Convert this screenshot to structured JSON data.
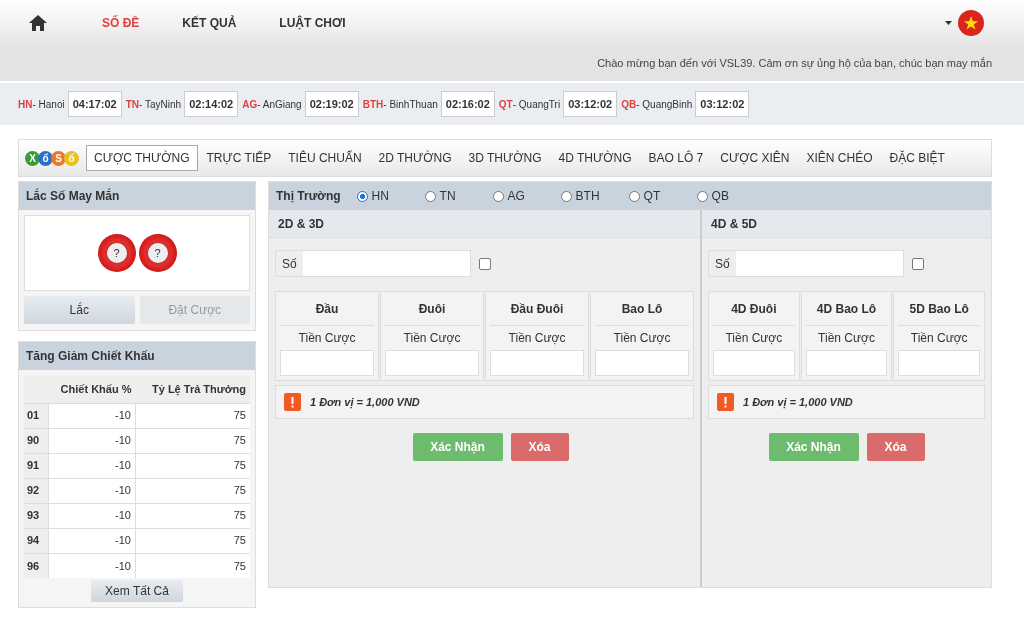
{
  "nav": {
    "items": [
      {
        "label": "SỐ ĐỀ",
        "selected": true
      },
      {
        "label": "KẾT QUẢ",
        "selected": false
      },
      {
        "label": "LUẬT CHƠI",
        "selected": false
      }
    ]
  },
  "welcome": "Chào mừng bạn đến với VSL39. Cảm ơn sự ủng hộ của bạn, chúc bạn may mắn",
  "timers": [
    {
      "code": "HN",
      "name": "- Hanoi",
      "time": "04:17:02"
    },
    {
      "code": "TN",
      "name": "- TayNinh",
      "time": "02:14:02"
    },
    {
      "code": "AG",
      "name": "- AnGiang",
      "time": "02:19:02"
    },
    {
      "code": "BTH",
      "name": "- BinhThuan",
      "time": "02:16:02"
    },
    {
      "code": "QT",
      "name": "- QuangTri",
      "time": "03:12:02"
    },
    {
      "code": "QB",
      "name": "- QuangBinh",
      "time": "03:12:02"
    }
  ],
  "logo": [
    {
      "letter": "X",
      "color": "#3a9a3a"
    },
    {
      "letter": "ổ",
      "color": "#2a6fc9"
    },
    {
      "letter": "S",
      "color": "#e8782a"
    },
    {
      "letter": "ố",
      "color": "#e8c020"
    }
  ],
  "tabs": [
    {
      "label": "CƯỢC THƯỜNG",
      "selected": true
    },
    {
      "label": "TRỰC TIẾP",
      "selected": false
    },
    {
      "label": "TIÊU CHUẨN",
      "selected": false
    },
    {
      "label": "2D THƯỜNG",
      "selected": false
    },
    {
      "label": "3D THƯỜNG",
      "selected": false
    },
    {
      "label": "4D THƯỜNG",
      "selected": false
    },
    {
      "label": "BAO LÔ 7",
      "selected": false
    },
    {
      "label": "CƯỢC XIÊN",
      "selected": false
    },
    {
      "label": "XIÊN CHÉO",
      "selected": false
    },
    {
      "label": "ĐẶC BIỆT",
      "selected": false
    }
  ],
  "lucky": {
    "title": "Lắc Số May Mắn",
    "balls": [
      "?",
      "?"
    ],
    "buttons": [
      {
        "label": "Lắc",
        "disabled": false
      },
      {
        "label": "Đặt Cược",
        "disabled": true
      }
    ]
  },
  "discount": {
    "title": "Tăng Giảm Chiết Khấu",
    "columns": [
      "",
      "Chiết Khấu %",
      "Tỷ Lệ Trả Thưởng"
    ],
    "rows": [
      [
        "01",
        "-10",
        "75"
      ],
      [
        "90",
        "-10",
        "75"
      ],
      [
        "91",
        "-10",
        "75"
      ],
      [
        "92",
        "-10",
        "75"
      ],
      [
        "93",
        "-10",
        "75"
      ],
      [
        "94",
        "-10",
        "75"
      ],
      [
        "96",
        "-10",
        "75"
      ]
    ],
    "button": "Xem Tất Cả"
  },
  "market": {
    "label": "Thị Trường",
    "options": [
      {
        "label": "HN",
        "selected": true
      },
      {
        "label": "TN",
        "selected": false
      },
      {
        "label": "AG",
        "selected": false
      },
      {
        "label": "BTH",
        "selected": false
      },
      {
        "label": "QT",
        "selected": false
      },
      {
        "label": "QB",
        "selected": false
      }
    ]
  },
  "panels": [
    {
      "title": "2D & 3D",
      "number_label": "Số",
      "checked": false,
      "bets": [
        {
          "title": "Đầu",
          "sub": "Tiền Cược"
        },
        {
          "title": "Đuôi",
          "sub": "Tiền Cược"
        },
        {
          "title": "Đầu Đuôi",
          "sub": "Tiền Cược"
        },
        {
          "title": "Bao Lô",
          "sub": "Tiền Cược"
        }
      ],
      "note": "1 Đơn vị = 1,000 VND",
      "confirm": "Xác Nhận",
      "clear": "Xóa"
    },
    {
      "title": "4D & 5D",
      "number_label": "Số",
      "checked": false,
      "bets": [
        {
          "title": "4D Đuôi",
          "sub": "Tiền Cược"
        },
        {
          "title": "4D Bao Lô",
          "sub": "Tiền Cược"
        },
        {
          "title": "5D Bao Lô",
          "sub": "Tiền Cược"
        }
      ],
      "note": "1 Đơn vị = 1,000 VND",
      "confirm": "Xác Nhận",
      "clear": "Xóa"
    }
  ]
}
